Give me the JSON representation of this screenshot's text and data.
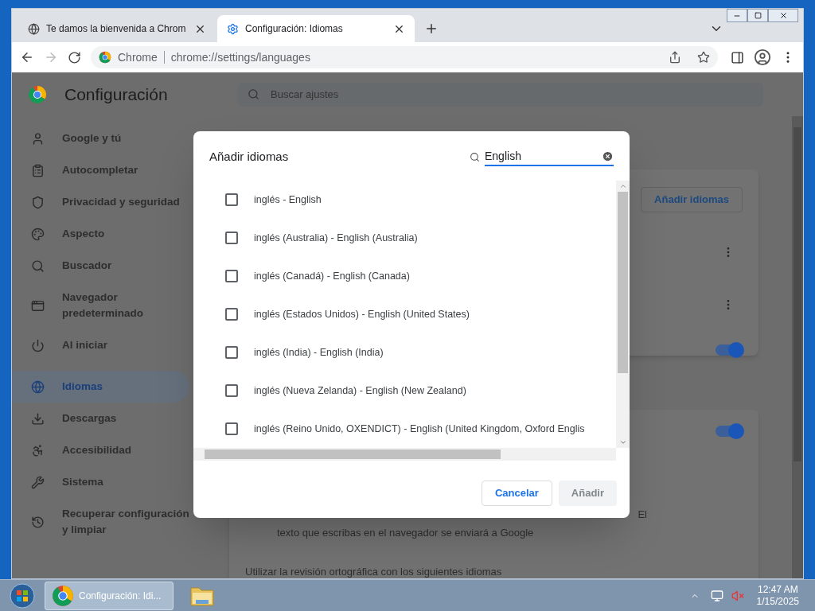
{
  "browser": {
    "tabs": [
      {
        "title": "Te damos la bienvenida a Chrom",
        "kind": "web",
        "selected": false
      },
      {
        "title": "Configuración: Idiomas",
        "kind": "settings",
        "selected": true
      }
    ],
    "toolbar": {
      "site_label": "Chrome",
      "url": "chrome://settings/languages",
      "forward_disabled": true
    }
  },
  "settings": {
    "title": "Configuración",
    "search": {
      "placeholder": "Buscar ajustes"
    },
    "sidebar": {
      "items": [
        {
          "label": "Google y tú",
          "selected": false
        },
        {
          "label": "Autocompletar",
          "selected": false
        },
        {
          "label": "Privacidad y seguridad",
          "selected": false
        },
        {
          "label": "Aspecto",
          "selected": false
        },
        {
          "label": "Buscador",
          "selected": false
        },
        {
          "label": "Navegador predeterminado",
          "selected": false
        },
        {
          "label": "Al iniciar",
          "selected": false
        },
        {
          "label": "Idiomas",
          "selected": true
        },
        {
          "label": "Descargas",
          "selected": false
        },
        {
          "label": "Accesibilidad",
          "selected": false
        },
        {
          "label": "Sistema",
          "selected": false
        },
        {
          "label": "Recuperar configuración y limpiar",
          "selected": false
        }
      ]
    },
    "languages_card": {
      "add_button": "Añadir idiomas",
      "toggle_on": true
    },
    "spell_card": {
      "toggle_on": true,
      "fragment": "El",
      "description": "texto que escribas en el navegador se enviará a Google",
      "spellcheck_label": "Utilizar la revisión ortográfica con los siguientes idiomas"
    }
  },
  "dialog": {
    "title": "Añadir idiomas",
    "search": {
      "value": "English"
    },
    "languages": [
      {
        "label": "inglés - English",
        "checked": false
      },
      {
        "label": "inglés (Australia) - English (Australia)",
        "checked": false
      },
      {
        "label": "inglés (Canadá) - English (Canada)",
        "checked": false
      },
      {
        "label": "inglés (Estados Unidos) - English (United States)",
        "checked": false
      },
      {
        "label": "inglés (India) - English (India)",
        "checked": false
      },
      {
        "label": "inglés (Nueva Zelanda) - English (New Zealand)",
        "checked": false
      },
      {
        "label": "inglés (Reino Unido, OXENDICT) - English (United Kingdom, Oxford Englis",
        "checked": false
      }
    ],
    "buttons": [
      {
        "label": "Cancelar",
        "kind": "secondary",
        "disabled": false
      },
      {
        "label": "Añadir",
        "kind": "primary",
        "disabled": true
      }
    ]
  },
  "taskbar": {
    "apps": [
      {
        "label": "Configuración: Idi...",
        "kind": "chrome",
        "active": true
      },
      {
        "kind": "folder",
        "active": false
      }
    ],
    "clock": {
      "time": "12:47 AM",
      "date": "1/15/2025"
    }
  }
}
